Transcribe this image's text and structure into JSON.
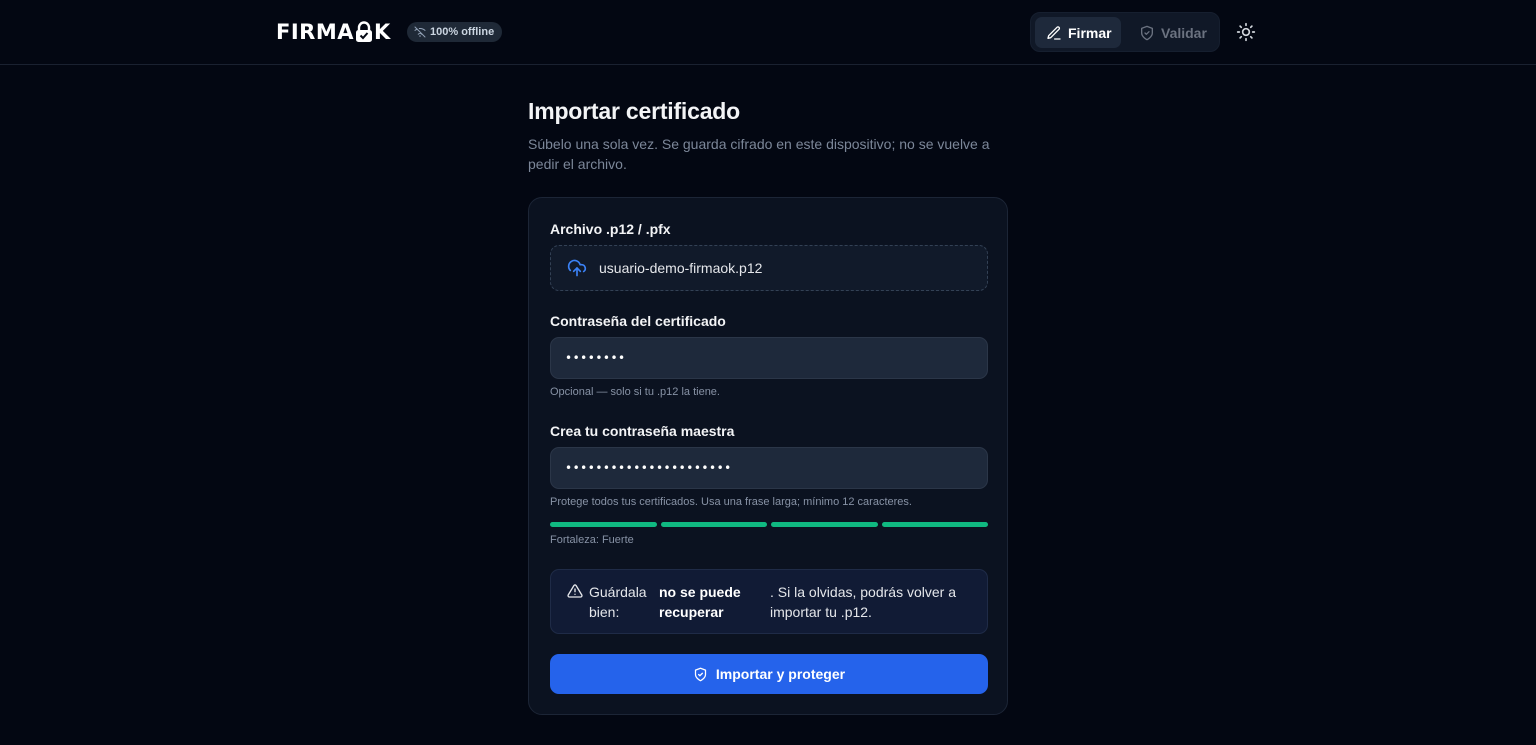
{
  "header": {
    "logo_left": "FIRMA",
    "logo_right": "K",
    "offline_badge": "100% offline",
    "nav": {
      "firmar": "Firmar",
      "validar": "Validar"
    }
  },
  "main": {
    "title": "Importar certificado",
    "subtitle": "Súbelo una sola vez. Se guarda cifrado en este dispositivo; no se vuelve a pedir el archivo."
  },
  "form": {
    "file_label": "Archivo .p12 / .pfx",
    "file_name": "usuario-demo-firmaok.p12",
    "cert_password_label": "Contraseña del certificado",
    "cert_password_value": "••••••••",
    "cert_password_hint": "Opcional — solo si tu .p12 la tiene.",
    "master_password_label": "Crea tu contraseña maestra",
    "master_password_value": "••••••••••••••••••••••",
    "master_password_hint": "Protege todos tus certificados. Usa una frase larga; mínimo 12 caracteres.",
    "strength_level": 4,
    "strength_max": 4,
    "strength_text": "Fortaleza: Fuerte",
    "warning_part1": "Guárdala bien:",
    "warning_bold": "no se puede recuperar",
    "warning_part2": ". Si la olvidas, podrás volver a importar tu .p12.",
    "submit_label": "Importar y proteger"
  },
  "colors": {
    "background": "#030712",
    "accent": "#2563eb",
    "strength": "#10b981",
    "card": "#0b1220"
  },
  "icons": [
    "wifi-off-icon",
    "pen-icon",
    "shield-check-icon",
    "sun-icon",
    "cloud-upload-icon",
    "warning-triangle-icon",
    "shield-icon",
    "lock-icon"
  ]
}
